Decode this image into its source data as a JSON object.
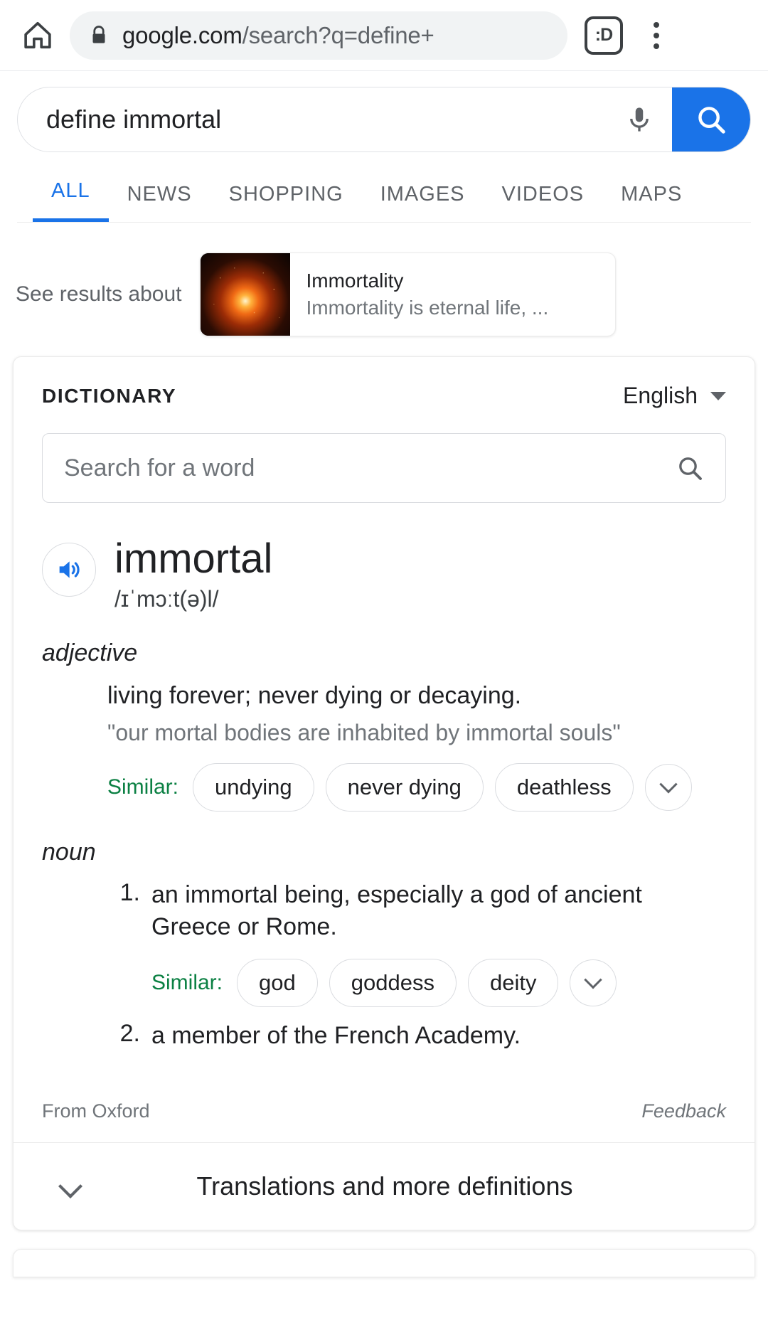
{
  "browser": {
    "home_icon": "home-icon",
    "lock_icon": "lock-icon",
    "url_host": "google.com",
    "url_path": "/search?q=define+",
    "tab_count_label": ":D",
    "menu_icon": "overflow-menu-icon"
  },
  "search": {
    "query": "define immortal",
    "mic_icon": "microphone-icon",
    "submit_icon": "search-icon"
  },
  "tabs": [
    {
      "label": "ALL",
      "active": true
    },
    {
      "label": "NEWS",
      "active": false
    },
    {
      "label": "SHOPPING",
      "active": false
    },
    {
      "label": "IMAGES",
      "active": false
    },
    {
      "label": "VIDEOS",
      "active": false
    },
    {
      "label": "MAPS",
      "active": false
    }
  ],
  "results_about": {
    "label": "See results about",
    "entity_title": "Immortality",
    "entity_desc": "Immortality is eternal life, ..."
  },
  "dictionary": {
    "section_label": "DICTIONARY",
    "language": "English",
    "word_search_placeholder": "Search for a word",
    "word_search_icon": "search-icon",
    "speaker_icon": "speaker-icon",
    "headword": "immortal",
    "phonetic": "/ɪˈmɔːt(ə)l/",
    "entries": [
      {
        "pos": "adjective",
        "numbered": false,
        "senses": [
          {
            "number": "",
            "definition": "living forever; never dying or decaying.",
            "example": "\"our mortal bodies are inhabited by immortal souls\"",
            "similar_label": "Similar:",
            "similar": [
              "undying",
              "never dying",
              "deathless"
            ],
            "more_icon": "chevron-down-icon"
          }
        ]
      },
      {
        "pos": "noun",
        "numbered": true,
        "senses": [
          {
            "number": "1.",
            "definition": "an immortal being, especially a god of ancient Greece or Rome.",
            "example": "",
            "similar_label": "Similar:",
            "similar": [
              "god",
              "goddess",
              "deity"
            ],
            "more_icon": "chevron-down-icon"
          },
          {
            "number": "2.",
            "definition": "a member of the French Academy.",
            "example": "",
            "similar_label": "",
            "similar": [],
            "more_icon": ""
          }
        ]
      }
    ],
    "source": "From Oxford",
    "feedback": "Feedback",
    "expander_label": "Translations and more definitions",
    "expander_icon": "chevron-down-icon"
  },
  "colors": {
    "accent": "#1a73e8",
    "similar_green": "#0b8043",
    "text_primary": "#202124",
    "text_secondary": "#70757a"
  }
}
